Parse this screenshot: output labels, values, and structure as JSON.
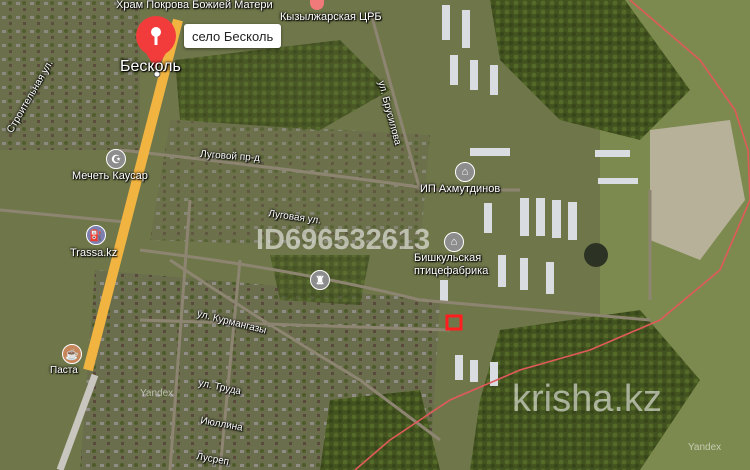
{
  "pin": {
    "label": "село Бесколь"
  },
  "places": {
    "beskol": "Бесколь",
    "church": "Храм Покрова Божией Матери",
    "crb": "Кызылжарская ЦРБ",
    "mosque": "Мечеть Каусар",
    "trassa": "Trassa.kz",
    "ip": "ИП Ахмутдинов",
    "factory_line1": "Бишкульская",
    "factory_line2": "птицефабрика",
    "cafe": "Паста"
  },
  "streets": {
    "brusilova": "ул. Брусилова",
    "lugovoy_pr": "Луговой пр-д",
    "lugovaya": "Луговая ул.",
    "kurmangazy": "ул. Курмангазы",
    "truda": "ул. Труда",
    "stroitelnaya": "Строительная ул.",
    "iyullina": "Июллина",
    "lusrep": "Лусреп"
  },
  "watermarks": {
    "id": "ID696532613",
    "site": "krisha.kz",
    "yandex1": "Yandex",
    "yandex2": "Yandex"
  },
  "colors": {
    "pin": "#f23c3c",
    "highway": "#f2b441",
    "boundary": "#e05a5a",
    "plot_marker": "#ff1d1d"
  },
  "icons": [
    "location-pin-icon",
    "mosque-icon",
    "fuel-icon",
    "poi-icon",
    "cafe-icon",
    "hospital-icon"
  ]
}
